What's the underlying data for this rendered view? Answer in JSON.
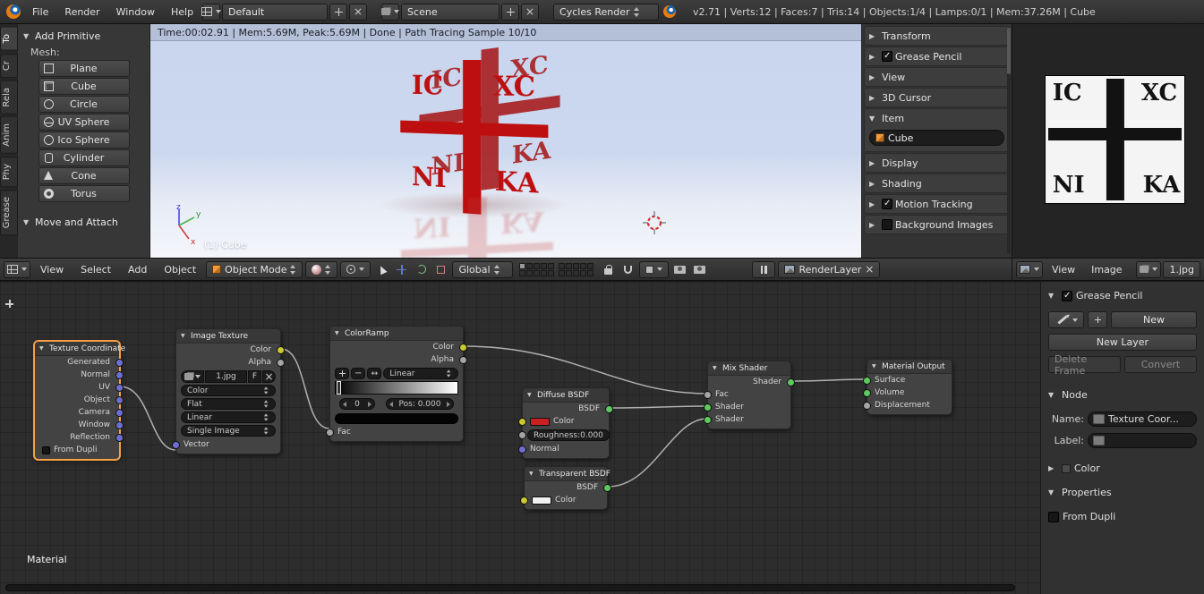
{
  "topbar": {
    "menus": [
      "File",
      "Render",
      "Window",
      "Help"
    ],
    "layout_name": "Default",
    "scene_name": "Scene",
    "engine": "Cycles Render",
    "stats": "v2.71 | Verts:12 | Faces:7 | Tris:14 | Objects:1/4 | Lamps:0/1 | Mem:37.26M | Cube"
  },
  "toolshelf": {
    "tabs": [
      "To",
      "Cr",
      "Rela",
      "Anim",
      "Phy",
      "Grease"
    ],
    "add_primitive_title": "Add Primitive",
    "mesh_label": "Mesh:",
    "mesh_items": [
      "Plane",
      "Cube",
      "Circle",
      "UV Sphere",
      "Ico Sphere",
      "Cylinder",
      "Cone",
      "Torus"
    ],
    "move_attach_title": "Move and Attach"
  },
  "viewport": {
    "render_status": "Time:00:02.91 | Mem:5.69M, Peak:5.69M | Done | Path Tracing Sample 10/10",
    "object_label": "(1) Cube",
    "axis": {
      "x": "x",
      "y": "y",
      "z": "z"
    }
  },
  "npanel": {
    "sections": [
      {
        "label": "Transform"
      },
      {
        "label": "Grease Pencil"
      },
      {
        "label": "View"
      },
      {
        "label": "3D Cursor"
      },
      {
        "label": "Item"
      },
      {
        "label": "Display"
      },
      {
        "label": "Shading"
      },
      {
        "label": "Motion Tracking"
      },
      {
        "label": "Background Images"
      }
    ],
    "item_name_value": "Cube"
  },
  "viewport_header": {
    "menus": [
      "View",
      "Select",
      "Add",
      "Object"
    ],
    "mode": "Object Mode",
    "orientation": "Global",
    "render_layer": "RenderLayer"
  },
  "image_editor": {
    "menus": [
      "View",
      "Image"
    ],
    "image_name": "1.jpg",
    "christogram": {
      "tl": "IC",
      "tr": "XC",
      "bl": "NI",
      "br": "KA"
    }
  },
  "node_editor": {
    "breadcrumb": "Material",
    "nodes": {
      "texture_coordinate": {
        "title": "Texture Coordinate",
        "outputs": [
          "Generated",
          "Normal",
          "UV",
          "Object",
          "Camera",
          "Window",
          "Reflection"
        ],
        "from_dupli": "From Dupli"
      },
      "image_texture": {
        "title": "Image Texture",
        "outputs": [
          "Color",
          "Alpha"
        ],
        "image_name": "1.jpg",
        "fake_user": "F",
        "options": [
          "Color",
          "Flat",
          "Linear",
          "Single Image"
        ],
        "input": "Vector"
      },
      "color_ramp": {
        "title": "ColorRamp",
        "outputs": [
          "Color",
          "Alpha"
        ],
        "interpolation": "Linear",
        "index": "0",
        "pos": "Pos: 0.000",
        "input": "Fac"
      },
      "diffuse_bsdf": {
        "title": "Diffuse BSDF",
        "output": "BSDF",
        "color_label": "Color",
        "roughness": "Roughness:0.000",
        "normal_label": "Normal"
      },
      "transparent_bsdf": {
        "title": "Transparent BSDF",
        "output": "BSDF",
        "color_label": "Color"
      },
      "mix_shader": {
        "title": "Mix Shader",
        "output": "Shader",
        "inputs": [
          "Fac",
          "Shader",
          "Shader"
        ]
      },
      "material_output": {
        "title": "Material Output",
        "inputs": [
          "Surface",
          "Volume",
          "Displacement"
        ]
      }
    },
    "sidebar": {
      "grease_pencil_title": "Grease Pencil",
      "new_button": "New",
      "new_layer_button": "New Layer",
      "delete_frame_button": "Delete Frame",
      "convert_button": "Convert",
      "node_title": "Node",
      "name_label": "Name:",
      "name_value": "Texture Coor...",
      "label_label": "Label:",
      "color_title": "Color",
      "properties_title": "Properties",
      "from_dupli": "From Dupli"
    }
  }
}
